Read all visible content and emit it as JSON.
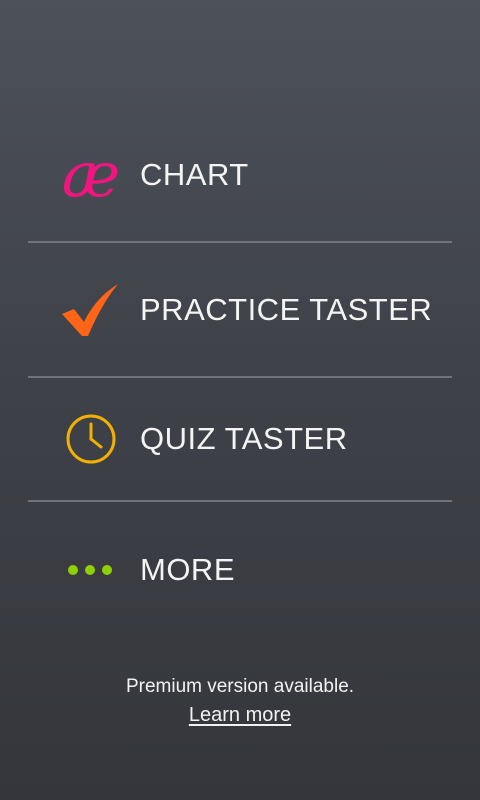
{
  "menu": {
    "items": [
      {
        "label": "CHART",
        "icon": "ae-ligature-icon",
        "icon_glyph": "æ",
        "icon_color": "#f0157f"
      },
      {
        "label": "PRACTICE TASTER",
        "icon": "checkmark-icon",
        "icon_color": "#ff6417"
      },
      {
        "label": "QUIZ TASTER",
        "icon": "clock-icon",
        "icon_color": "#f3b000"
      },
      {
        "label": "MORE",
        "icon": "more-dots-icon",
        "icon_color": "#8ed000"
      }
    ]
  },
  "footer": {
    "premium_text": "Premium version available.",
    "learn_more_label": "Learn more"
  }
}
